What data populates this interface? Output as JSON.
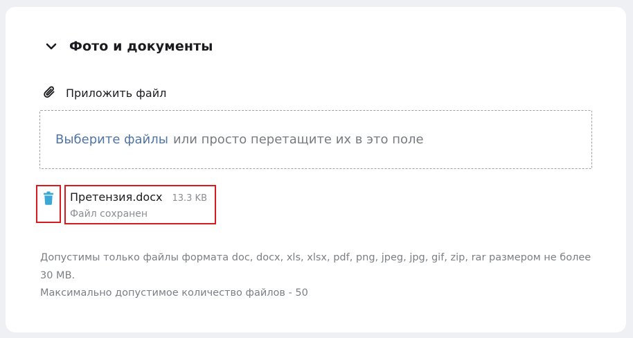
{
  "section": {
    "title": "Фото и документы",
    "expand_icon": "chevron-down-icon"
  },
  "attach": {
    "label": "Приложить файл",
    "icon": "paperclip-icon"
  },
  "dropzone": {
    "link_text": "Выберите файлы",
    "rest_text": "или просто перетащите их в это поле"
  },
  "file": {
    "name": "Претензия.docx",
    "size": "13.3 KB",
    "status": "Файл сохранен",
    "delete_icon": "trash-icon"
  },
  "hints": {
    "formats": "Допустимы только файлы формата doc, docx, xls, xlsx, pdf, png, jpeg, jpg, gif, zip, rar размером не более 30 MB.",
    "max_files": "Максимально допустимое количество файлов - 50"
  },
  "colors": {
    "accent_link": "#4f74a6",
    "trash_icon": "#3aa7d6",
    "highlight_border": "#d71920"
  }
}
